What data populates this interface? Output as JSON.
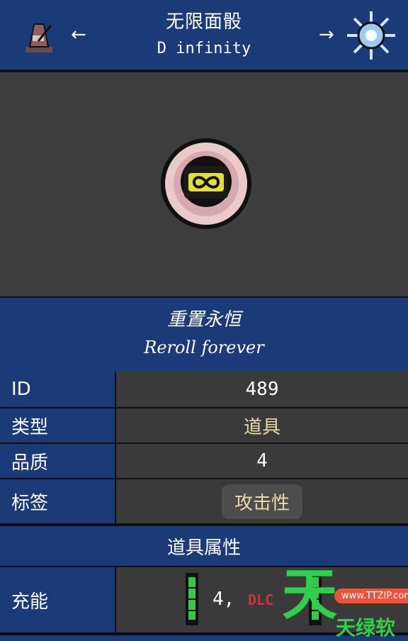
{
  "header": {
    "title_zh": "无限面骰",
    "title_en": "D infinity",
    "prev_arrow": "←",
    "next_arrow": "→",
    "prev_icon": "metronome-icon",
    "next_icon": "star-burst-icon"
  },
  "item": {
    "sprite_icon": "d-infinity-icon",
    "name_zh": "重置永恒",
    "name_en": "Reroll forever"
  },
  "info": [
    {
      "label": "ID",
      "value": "489"
    },
    {
      "label": "类型",
      "value": "道具"
    },
    {
      "label": "品质",
      "value": "4"
    },
    {
      "label": "标签",
      "value": "攻击性"
    }
  ],
  "attributes": {
    "section_title": "道具属性",
    "charge_label": "充能",
    "charge_text": "4,",
    "dlc_text": "DLC",
    "battery_icon": "battery-icon"
  },
  "watermark": {
    "big": "天",
    "sub": "天绿软",
    "pill": "www.TTZIP.com"
  },
  "colors": {
    "panel_blue": "#1b3a78",
    "value_gray": "#3a3a3a",
    "image_bg": "#3d3d3d",
    "accent_gold": "#e8d9a8",
    "battery_green": "#39c44a",
    "dlc_red": "#c0393e"
  }
}
